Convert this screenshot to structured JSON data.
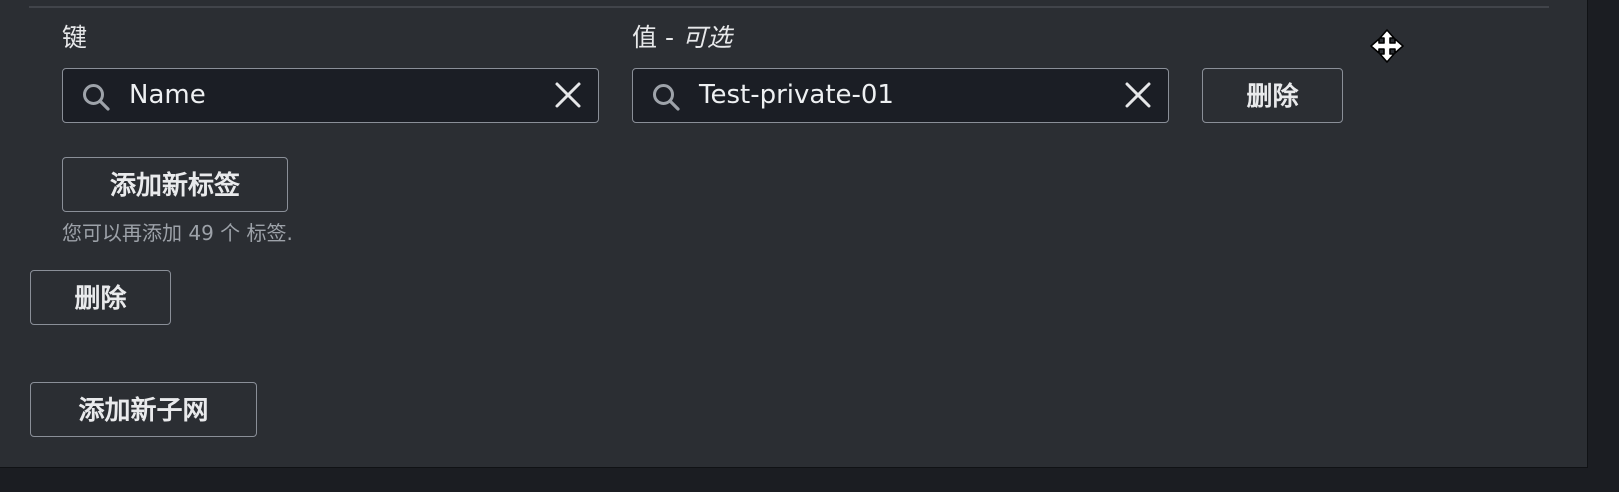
{
  "tag_row": {
    "key_label": "键",
    "value_label_prefix": "值",
    "value_label_dash": "-",
    "value_label_optional": "可选",
    "key_input": {
      "value": "Name",
      "icon": "search-icon",
      "clear_icon": "close-icon"
    },
    "value_input": {
      "value": "Test-private-01",
      "icon": "search-icon",
      "clear_icon": "close-icon"
    },
    "remove_tag_label": "删除"
  },
  "add_tag_label": "添加新标签",
  "tag_hint": "您可以再添加 49 个 标签.",
  "remove_subnet_label": "删除",
  "add_subnet_label": "添加新子网",
  "cursor": "move-cursor-icon",
  "colors": {
    "panel_bg": "#2b2e33",
    "page_bg": "#1b1d22",
    "input_bg": "#1b1e25",
    "border": "#8a8f98",
    "text": "#e7e8ea",
    "muted_text": "#9da2a9"
  }
}
